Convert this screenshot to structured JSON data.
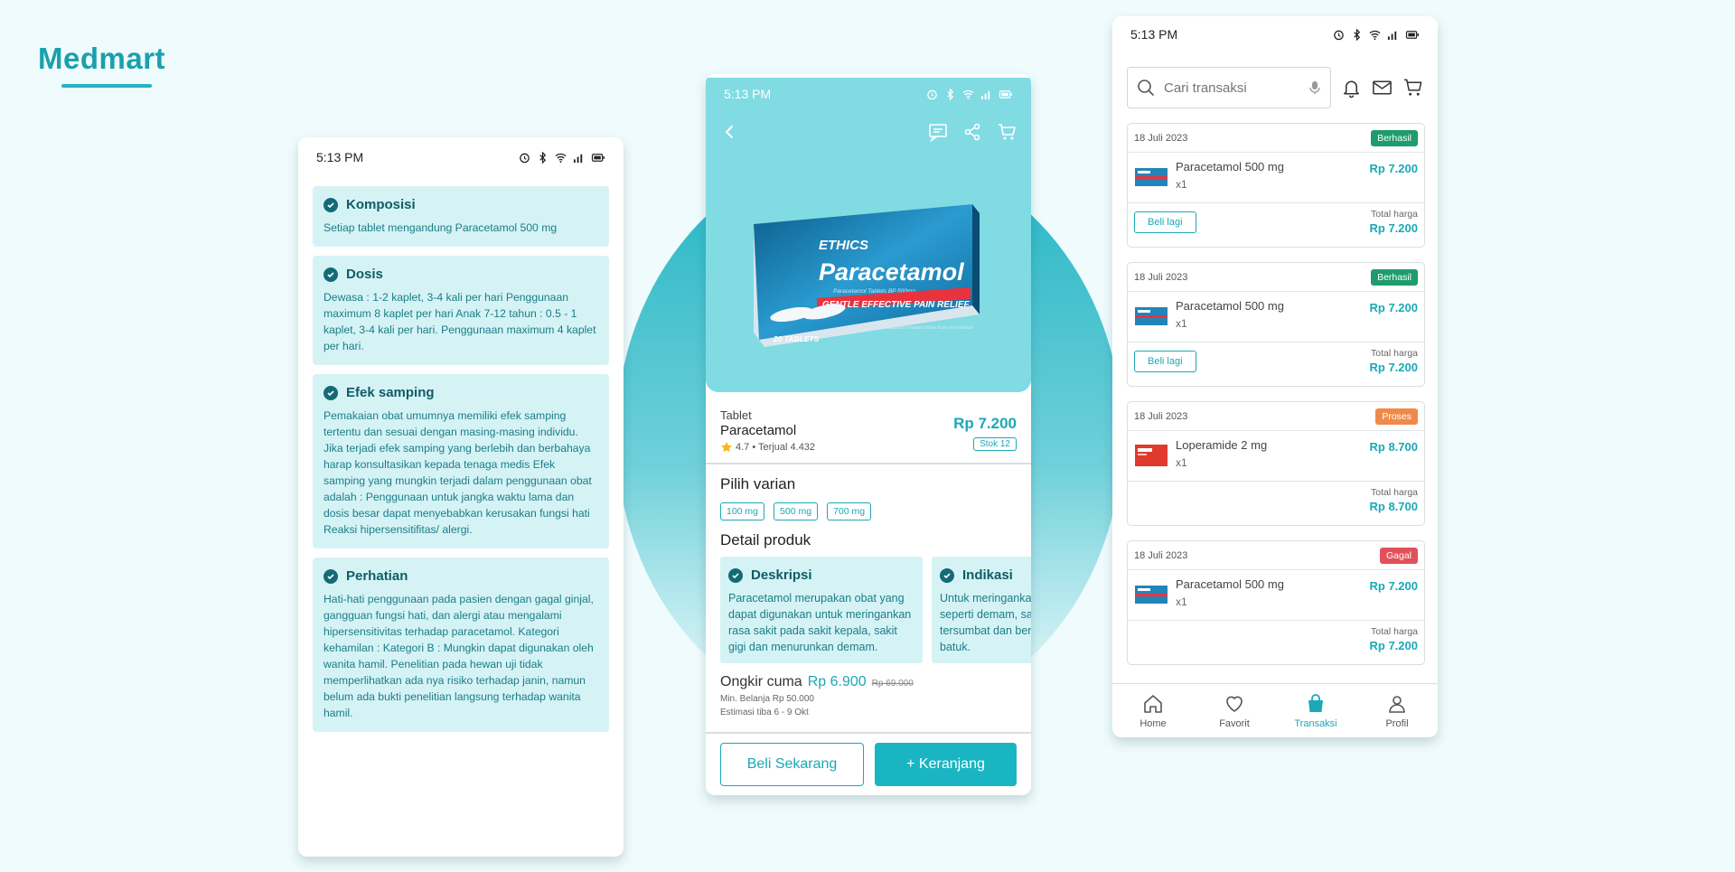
{
  "brand": "Medmart",
  "status_time": "5:13 PM",
  "colors": {
    "accent": "#19a9b8",
    "card_bg": "#d5f3f5",
    "success": "#1e9c6c",
    "process": "#f08a4b",
    "failed": "#e2515a"
  },
  "screen1": {
    "sections": [
      {
        "title": "Komposisi",
        "body": "Setiap tablet mengandung Paracetamol 500 mg"
      },
      {
        "title": "Dosis",
        "body": "Dewasa : 1-2 kaplet, 3-4 kali per hari Penggunaan maximum 8 kaplet per hari Anak 7-12 tahun : 0.5 - 1 kaplet, 3-4 kali per hari. Penggunaan maximum 4 kaplet per hari."
      },
      {
        "title": "Efek samping",
        "body": "Pemakaian obat umumnya memiliki efek samping tertentu dan sesuai dengan masing-masing individu. Jika terjadi efek samping yang berlebih dan berbahaya harap konsultasikan kepada tenaga medis Efek samping yang mungkin terjadi dalam penggunaan obat adalah : Penggunaan untuk jangka waktu lama dan dosis besar dapat menyebabkan kerusakan fungsi hati  Reaksi hipersensitifitas/ alergi."
      },
      {
        "title": "Perhatian",
        "body": "Hati-hati penggunaan pada pasien dengan gagal ginjal, gangguan fungsi hati, dan alergi atau mengalami hipersensitivitas terhadap paracetamol. Kategori kehamilan : Kategori B : Mungkin dapat digunakan oleh wanita hamil. Penelitian pada hewan uji tidak memperlihatkan ada nya risiko terhadap janin, namun belum ada bukti penelitian langsung terhadap wanita hamil."
      }
    ]
  },
  "screen2": {
    "product_box": {
      "brand": "ETHICS",
      "name": "Paracetamol",
      "subtitle": "Paracetamol Tablets BP 500mg",
      "banner": "GENTLE EFFECTIVE PAIN RELIEF",
      "count": "20 TABLETS",
      "side_note": "Smooth capsule shaped tablet Easy to swallow"
    },
    "type": "Tablet",
    "name": "Paracetamol",
    "rating": "4.7 • Terjual 4.432",
    "price": "Rp 7.200",
    "stock": "Stok 12",
    "variant_title": "Pilih varian",
    "variants": [
      "100 mg",
      "500 mg",
      "700 mg"
    ],
    "detail_title": "Detail produk",
    "details": [
      {
        "title": "Deskripsi",
        "body": "Paracetamol merupakan obat yang dapat digunakan untuk meringankan rasa sakit pada sakit kepala, sakit gigi dan menurunkan demam."
      },
      {
        "title": "Indikasi",
        "body": "Untuk meringankan rasa sakit seperti demam, sakit kepala, hidung tersumbat dan bersin yang disertai batuk."
      }
    ],
    "ongkir_label": "Ongkir cuma",
    "ongkir_price": "Rp 6.900",
    "ongkir_old": "Rp 69.000",
    "min_belanja": "Min. Belanja Rp 50.000",
    "estimasi": "Estimasi tiba 6 - 9 Okt",
    "btn_buy": "Beli Sekarang",
    "btn_cart": "+ Keranjang"
  },
  "screen3": {
    "search_placeholder": "Cari transaksi",
    "transactions": [
      {
        "date": "18 Juli 2023",
        "status": "Berhasil",
        "status_color": "#1e9c6c",
        "name": "Paracetamol 500 mg",
        "qty": "x1",
        "price": "Rp 7.200",
        "action": "Beli lagi",
        "total_label": "Total harga",
        "total": "Rp 7.200"
      },
      {
        "date": "18 Juli 2023",
        "status": "Berhasil",
        "status_color": "#1e9c6c",
        "name": "Paracetamol 500 mg",
        "qty": "x1",
        "price": "Rp 7.200",
        "action": "Beli lagi",
        "total_label": "Total harga",
        "total": "Rp 7.200"
      },
      {
        "date": "18 Juli 2023",
        "status": "Proses",
        "status_color": "#f08a4b",
        "name": "Loperamide 2 mg",
        "qty": "x1",
        "price": "Rp 8.700",
        "action": "",
        "total_label": "Total harga",
        "total": "Rp 8.700"
      },
      {
        "date": "18 Juli 2023",
        "status": "Gagal",
        "status_color": "#e2515a",
        "name": "Paracetamol 500 mg",
        "qty": "x1",
        "price": "Rp 7.200",
        "action": "",
        "total_label": "Total harga",
        "total": "Rp 7.200"
      }
    ],
    "nav": [
      {
        "label": "Home",
        "icon": "home-icon"
      },
      {
        "label": "Favorit",
        "icon": "heart-icon"
      },
      {
        "label": "Transaksi",
        "icon": "bag-icon"
      },
      {
        "label": "Profil",
        "icon": "user-icon"
      }
    ]
  }
}
